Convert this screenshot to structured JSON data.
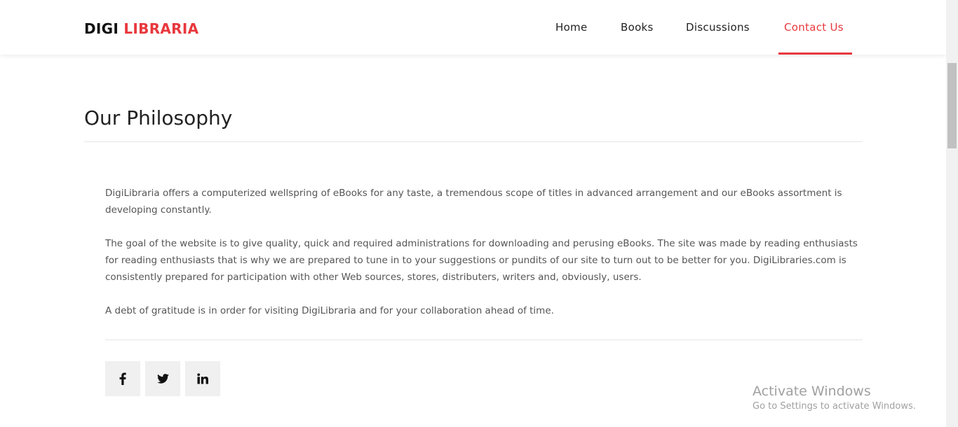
{
  "header": {
    "logo_part1": "DIGI",
    "logo_part2": "LIBRARIA",
    "nav": [
      {
        "label": "Home",
        "active": false
      },
      {
        "label": "Books",
        "active": false
      },
      {
        "label": "Discussions",
        "active": false
      },
      {
        "label": "Contact Us",
        "active": true
      }
    ]
  },
  "main": {
    "title": "Our Philosophy",
    "paragraphs": [
      "DigiLibraria offers a computerized wellspring of eBooks for any taste, a tremendous scope of titles in advanced arrangement and our eBooks assortment is developing constantly.",
      "The goal of the website is to give quality, quick and required administrations for downloading and perusing eBooks. The site was made by reading enthusiasts for reading enthusiasts that is why we are prepared to tune in to your suggestions or pundits of our site to turn out to be better for you. DigiLibraries.com is consistently prepared for participation with other Web sources, stores, distributers, writers and, obviously, users.",
      "A debt of gratitude is in order for visiting DigiLibraria and for your collaboration ahead of time."
    ],
    "social": [
      {
        "icon": "facebook-icon"
      },
      {
        "icon": "twitter-icon"
      },
      {
        "icon": "linkedin-icon"
      }
    ]
  },
  "watermark": {
    "title": "Activate Windows",
    "subtitle": "Go to Settings to activate Windows."
  },
  "colors": {
    "accent": "#e8383d",
    "text": "#555555",
    "social_bg": "#f0f0f0"
  }
}
